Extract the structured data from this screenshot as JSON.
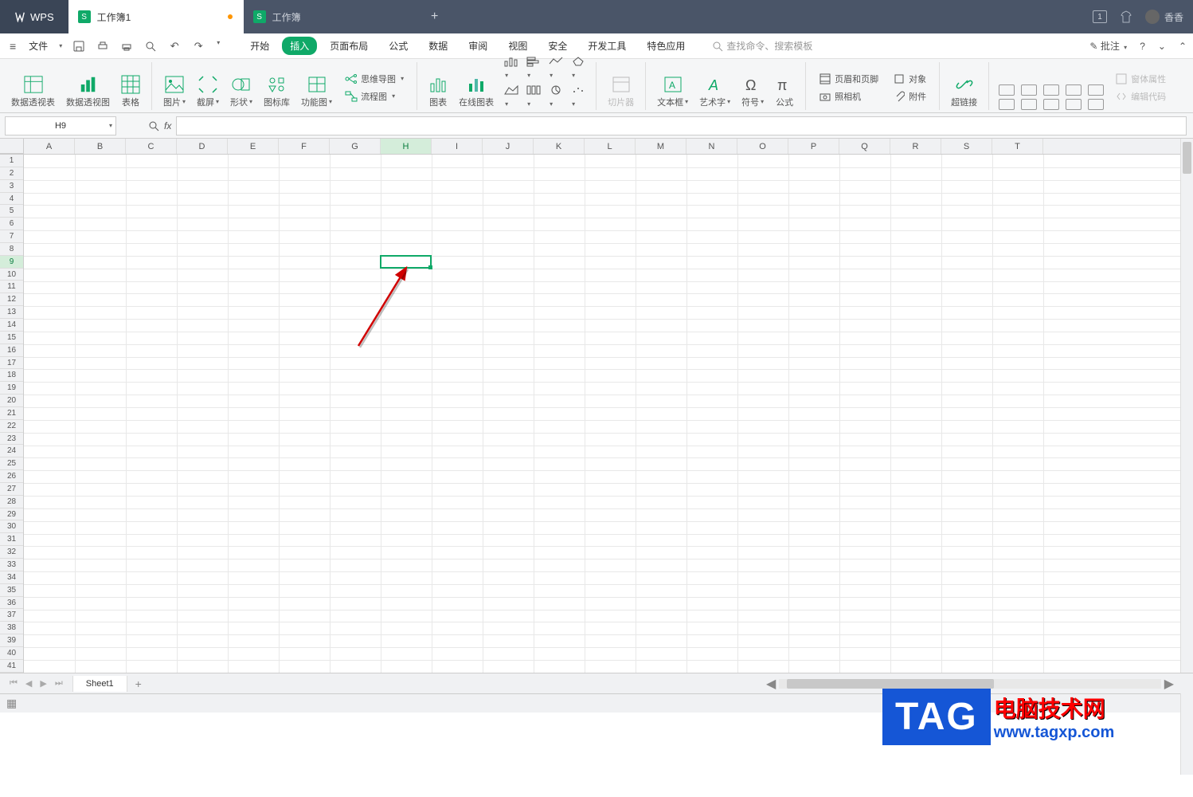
{
  "brand": "WPS",
  "doc_tabs": [
    {
      "title": "工作簿1",
      "modified": true
    },
    {
      "title": "工作簿",
      "modified": false
    }
  ],
  "user": {
    "name": "香香",
    "badge": "1"
  },
  "file_menu": "文件",
  "menu_tabs": {
    "start": "开始",
    "insert": "插入",
    "layout": "页面布局",
    "formula": "公式",
    "data": "数据",
    "review": "审阅",
    "view": "视图",
    "security": "安全",
    "dev": "开发工具",
    "special": "特色应用"
  },
  "search_placeholder": "查找命令、搜索模板",
  "annotate_label": "批注",
  "ribbon": {
    "pivot_table": "数据透视表",
    "pivot_chart": "数据透视图",
    "table": "表格",
    "picture": "图片",
    "screenshot": "截屏",
    "shape": "形状",
    "icon_lib": "图标库",
    "function_chart": "功能图",
    "mindmap": "思维导图",
    "flowchart": "流程图",
    "chart": "图表",
    "online_chart": "在线图表",
    "slicer": "切片器",
    "textbox": "文本框",
    "wordart": "艺术字",
    "symbol": "符号",
    "equation": "公式",
    "header_footer": "页眉和页脚",
    "object": "对象",
    "camera": "照相机",
    "attachment": "附件",
    "hyperlink": "超链接",
    "form_props": "窗体属性",
    "edit_code": "编辑代码"
  },
  "name_box": "H9",
  "columns": [
    "A",
    "B",
    "C",
    "D",
    "E",
    "F",
    "G",
    "H",
    "I",
    "J",
    "K",
    "L",
    "M",
    "N",
    "O",
    "P",
    "Q",
    "R",
    "S",
    "T"
  ],
  "row_count": 41,
  "active_col_index": 7,
  "active_row_index": 8,
  "sheet_name": "Sheet1",
  "watermark": {
    "tag": "TAG",
    "cn": "电脑技术网",
    "url": "www.tagxp.com"
  }
}
